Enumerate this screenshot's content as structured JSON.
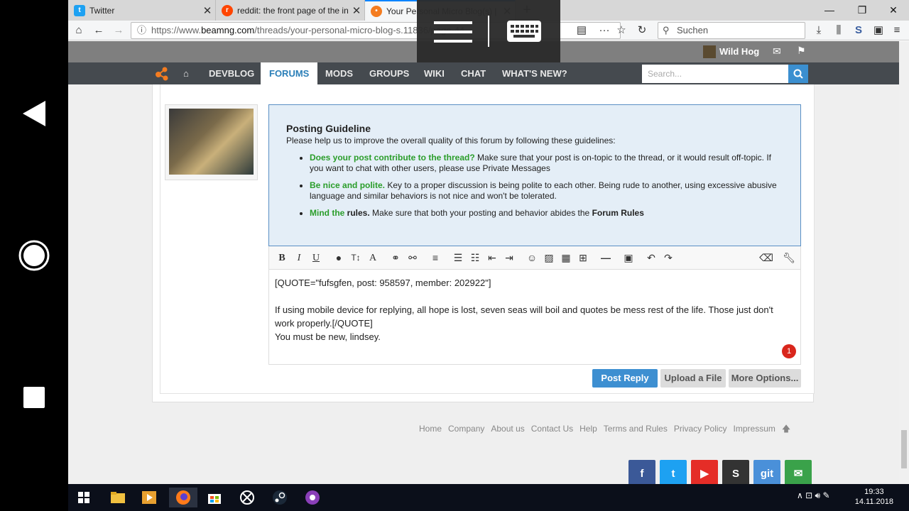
{
  "tabs": [
    {
      "title": "Twitter",
      "icon": "twitter-icon"
    },
    {
      "title": "reddit: the front page of the int",
      "icon": "reddit-icon"
    },
    {
      "title": "Your Personal Micro Blog(s) | P",
      "icon": "beamng-icon"
    }
  ],
  "url": {
    "prefix": "https://www.",
    "domain": "beamng.com",
    "path": "/threads/your-personal-micro-blog-s.11836/page-44"
  },
  "search_placeholder": "Suchen",
  "user": {
    "name": "Wild Hog"
  },
  "forum_nav": [
    "DEVBLOG",
    "FORUMS",
    "MODS",
    "GROUPS",
    "WIKI",
    "CHAT",
    "WHAT'S NEW?"
  ],
  "forum_search_placeholder": "Search...",
  "guideline": {
    "title": "Posting Guideline",
    "intro": "Please help us to improve the overall quality of this forum by following these guidelines:",
    "items": [
      {
        "lead": "Does your post contribute to the thread?",
        "text": " Make sure that your post is on-topic to the thread, or it would result off-topic. If you want to chat with other users, please use Private Messages"
      },
      {
        "lead": "Be nice and polite.",
        "text": " Key to a proper discussion is being polite to each other. Being rude to another, using excessive abusive language and similar behaviors is not nice and won't be tolerated."
      },
      {
        "lead": "Mind the",
        "lead_bold": " rules.",
        "text": " Make sure that both your posting and behavior abides the ",
        "link": "Forum Rules"
      }
    ]
  },
  "editor": {
    "line1": "[QUOTE=\"fufsgfen, post: 958597, member: 202922\"]",
    "line2": "If using mobile device for replying, all hope is lost, seven seas will boil and quotes be mess rest of the life. Those just don't work properly.[/QUOTE]",
    "line3": "You must be new, lindsey.",
    "notification_count": "1"
  },
  "buttons": {
    "post_reply": "Post Reply",
    "upload_file": "Upload a File",
    "more_options": "More Options..."
  },
  "footer_links": [
    "Home",
    "Company",
    "About us",
    "Contact Us",
    "Help",
    "Terms and Rules",
    "Privacy Policy",
    "Impressum"
  ],
  "social": [
    {
      "name": "facebook",
      "label": "f",
      "color": "#3b5998"
    },
    {
      "name": "twitter",
      "label": "t",
      "color": "#1da1f2"
    },
    {
      "name": "youtube",
      "label": "▶",
      "color": "#e52d27"
    },
    {
      "name": "steam",
      "label": "S",
      "color": "#333333"
    },
    {
      "name": "github",
      "label": "git",
      "color": "#4a90d9"
    },
    {
      "name": "email",
      "label": "✉",
      "color": "#3aa24a"
    }
  ],
  "clock": {
    "time": "19:33",
    "date": "14.11.2018"
  },
  "colors": {
    "accent": "#3d8fd1",
    "guideline_green": "#2a9d2a",
    "nav_dark": "#454a4f"
  }
}
